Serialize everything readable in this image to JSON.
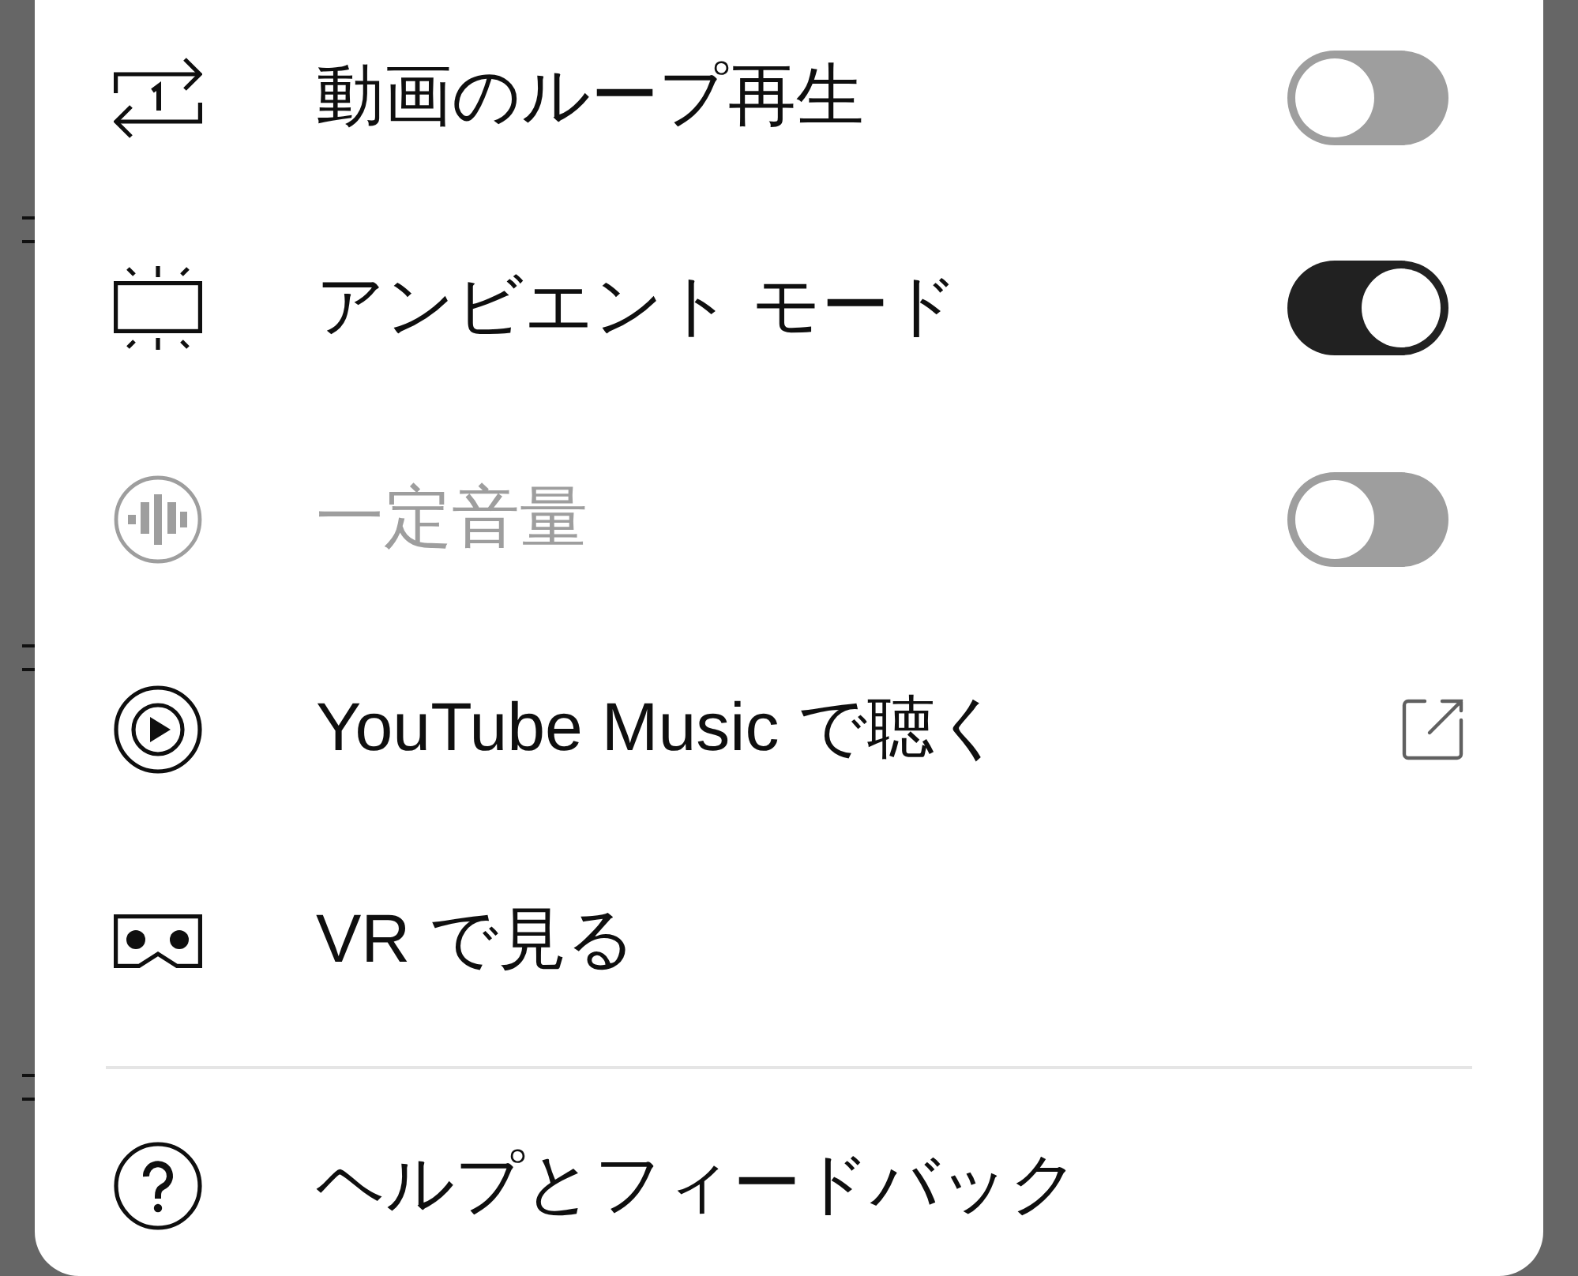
{
  "menu": {
    "sections": [
      {
        "items": [
          {
            "kind": "toggle",
            "label": "動画のループ再生",
            "on": false,
            "disabled": false
          },
          {
            "kind": "toggle",
            "label": "アンビエント モード",
            "on": true,
            "disabled": false
          },
          {
            "kind": "toggle",
            "label": "一定音量",
            "on": false,
            "disabled": true
          },
          {
            "kind": "external",
            "label": "YouTube Music で聴く",
            "disabled": false
          },
          {
            "kind": "plain",
            "label": "VR で見る",
            "disabled": false
          }
        ]
      },
      {
        "items": [
          {
            "kind": "plain",
            "label": "ヘルプとフィードバック",
            "disabled": false
          }
        ]
      }
    ]
  }
}
